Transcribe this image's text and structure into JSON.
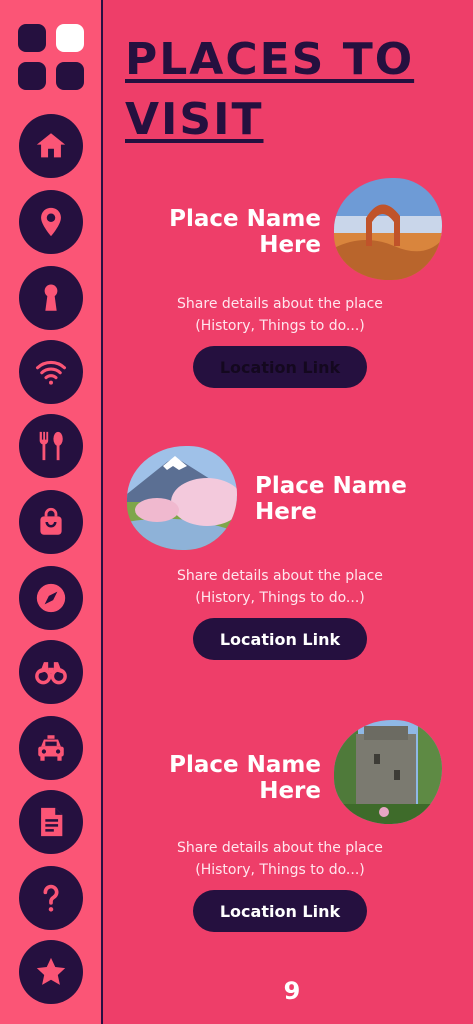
{
  "page": {
    "title_line1": "PLACES TO",
    "title_line2": "VISIT",
    "page_number": "9"
  },
  "sidebar": {
    "items": [
      {
        "icon": "home-icon"
      },
      {
        "icon": "location-pin-icon"
      },
      {
        "icon": "keyhole-icon"
      },
      {
        "icon": "wifi-icon"
      },
      {
        "icon": "fork-spoon-icon"
      },
      {
        "icon": "shopping-bag-icon"
      },
      {
        "icon": "compass-icon"
      },
      {
        "icon": "binoculars-icon"
      },
      {
        "icon": "taxi-icon"
      },
      {
        "icon": "document-icon"
      },
      {
        "icon": "question-icon"
      },
      {
        "icon": "star-icon"
      }
    ]
  },
  "places": [
    {
      "name_line1": "Place Name",
      "name_line2": "Here",
      "details_line1": "Share details about the place",
      "details_line2": "(History, Things to do...)",
      "link_label": "Location Link"
    },
    {
      "name_line1": "Place Name",
      "name_line2": "Here",
      "details_line1": "Share details about the place",
      "details_line2": "(History, Things to do...)",
      "link_label": "Location Link"
    },
    {
      "name_line1": "Place Name",
      "name_line2": "Here",
      "details_line1": "Share details about the place",
      "details_line2": "(History, Things to do...)",
      "link_label": "Location Link"
    }
  ],
  "colors": {
    "background": "#ee3e69",
    "sidebar": "#fb5576",
    "dark": "#25103f",
    "text": "#ffffff"
  }
}
